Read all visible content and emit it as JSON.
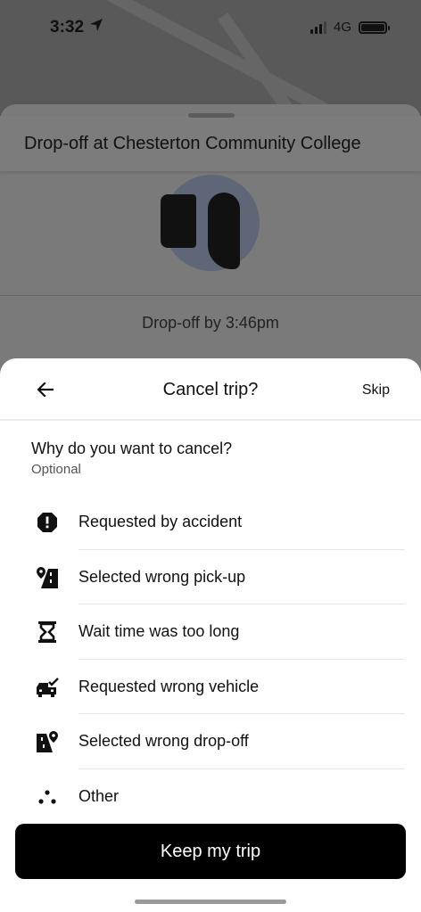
{
  "status_bar": {
    "time": "3:32",
    "network": "4G"
  },
  "trip": {
    "title": "Drop-off at Chesterton Community College",
    "dropoff_time": "Drop-off by 3:46pm"
  },
  "sheet": {
    "title": "Cancel trip?",
    "skip_label": "Skip",
    "question": "Why do you want to cancel?",
    "optional_label": "Optional",
    "reasons": [
      {
        "label": "Requested by accident",
        "icon": "warning-octagon-icon"
      },
      {
        "label": "Selected wrong pick-up",
        "icon": "pickup-route-icon"
      },
      {
        "label": "Wait time was too long",
        "icon": "hourglass-icon"
      },
      {
        "label": "Requested wrong vehicle",
        "icon": "car-check-icon"
      },
      {
        "label": "Selected wrong drop-off",
        "icon": "dropoff-route-icon"
      },
      {
        "label": "Other",
        "icon": "dots-icon"
      }
    ],
    "keep_label": "Keep my trip"
  }
}
